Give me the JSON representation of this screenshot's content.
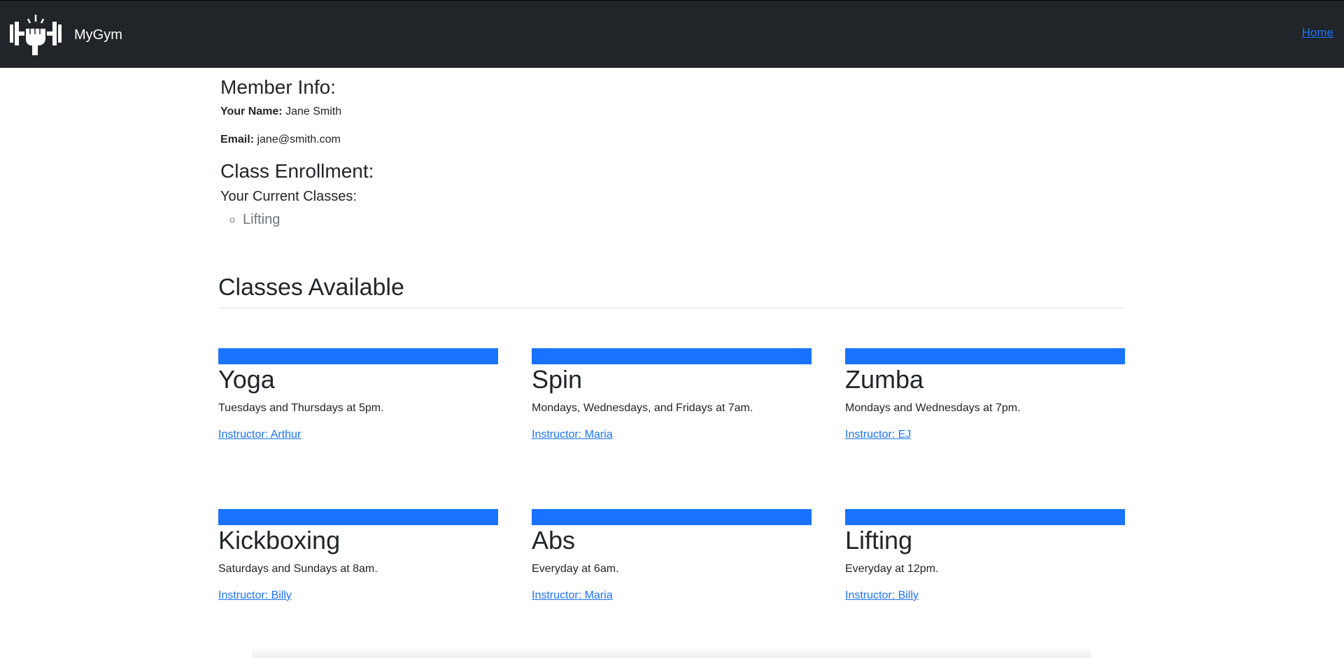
{
  "navbar": {
    "brand_name": "MyGym",
    "home_link": "Home",
    "logo_icon": "fist-dumbbell-icon"
  },
  "member": {
    "heading": "Member Info:",
    "name_label": "Your Name:",
    "name_value": "Jane Smith",
    "email_label": "Email:",
    "email_value": "jane@smith.com"
  },
  "enrollment": {
    "heading": "Class Enrollment:",
    "current_label": "Your Current Classes:",
    "current_classes": [
      "Lifting"
    ]
  },
  "classes": {
    "heading": "Classes Available",
    "accent_color": "#1a73ff",
    "items": [
      {
        "title": "Yoga",
        "schedule": "Tuesdays and Thursdays at 5pm.",
        "instructor": "Instructor: Arthur"
      },
      {
        "title": "Spin",
        "schedule": "Mondays, Wednesdays, and Fridays at 7am.",
        "instructor": "Instructor: Maria"
      },
      {
        "title": "Zumba",
        "schedule": "Mondays and Wednesdays at 7pm.",
        "instructor": "Instructor: EJ"
      },
      {
        "title": "Kickboxing",
        "schedule": "Saturdays and Sundays at 8am.",
        "instructor": "Instructor: Billy"
      },
      {
        "title": "Abs",
        "schedule": "Everyday at 6am.",
        "instructor": "Instructor: Maria"
      },
      {
        "title": "Lifting",
        "schedule": "Everyday at 12pm.",
        "instructor": "Instructor: Billy"
      }
    ]
  }
}
